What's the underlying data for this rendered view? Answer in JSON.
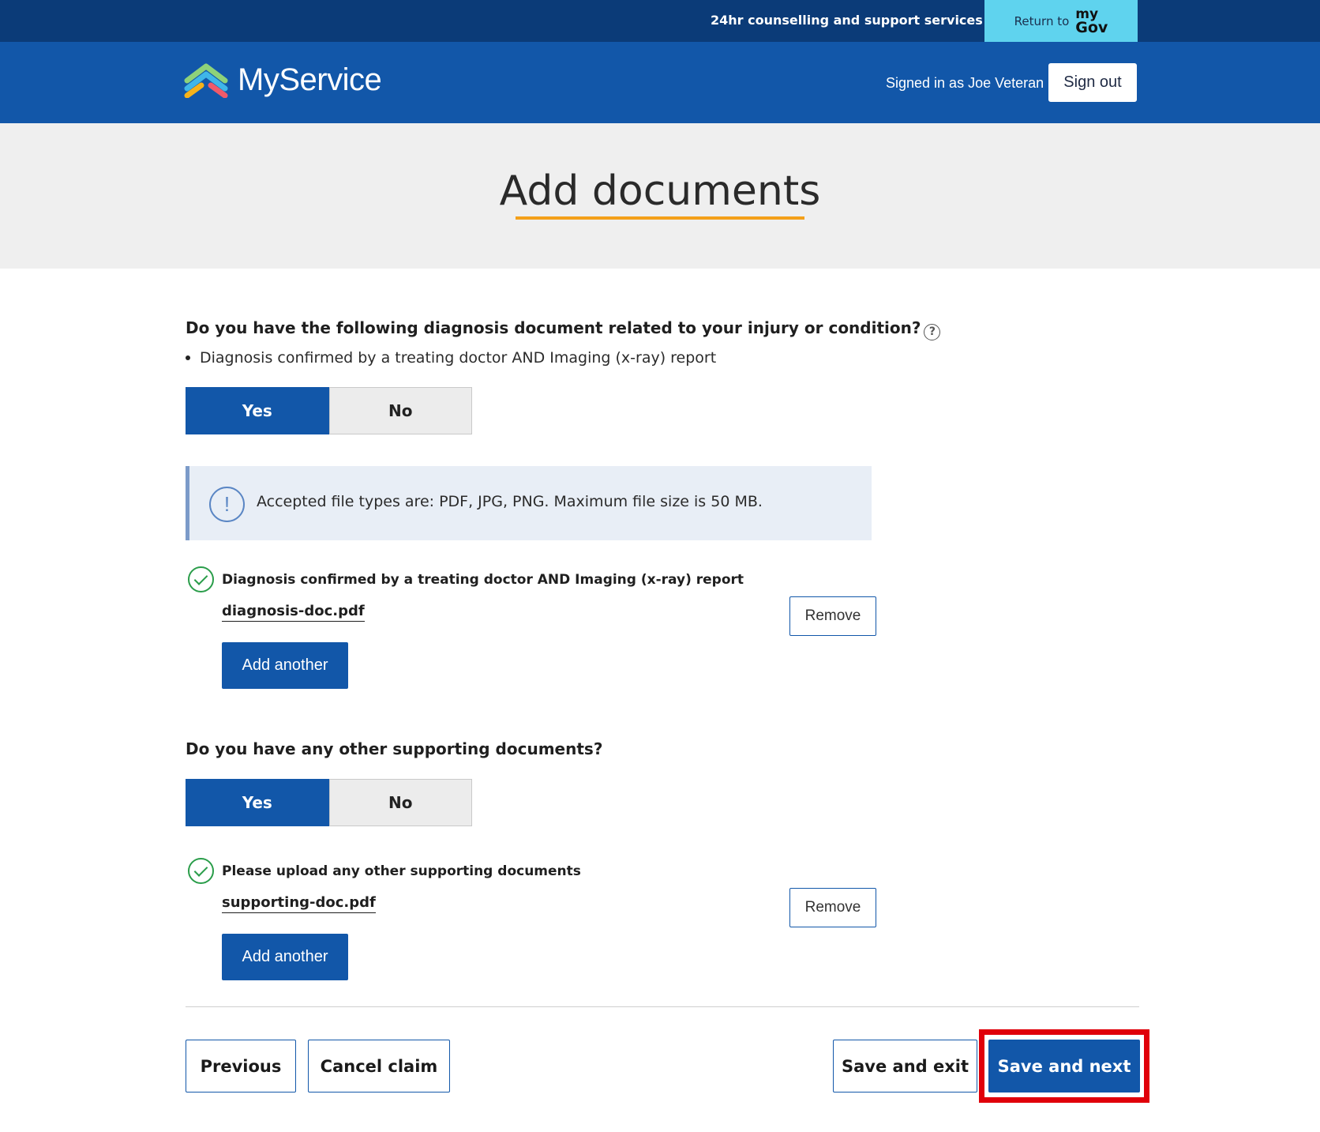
{
  "topbar": {
    "counselling_label": "24hr counselling and support services",
    "return_label": "Return to",
    "mygov_my": "my",
    "mygov_gov": "Gov"
  },
  "header": {
    "brand": "MyService",
    "signed_in": "Signed in as Joe Veteran",
    "sign_out": "Sign out"
  },
  "page": {
    "title": "Add documents"
  },
  "section1": {
    "question": "Do you have the following diagnosis document related to your injury or condition?",
    "help_icon": "?",
    "bullet": "Diagnosis confirmed by a treating doctor AND Imaging (x-ray) report",
    "yes": "Yes",
    "no": "No",
    "selected": "Yes",
    "info": "Accepted file types are: PDF, JPG, PNG. Maximum file size is 50 MB.",
    "upload_label": "Diagnosis confirmed by a treating doctor AND Imaging (x-ray) report",
    "file_name": "diagnosis-doc.pdf",
    "remove": "Remove",
    "add_another": "Add another"
  },
  "section2": {
    "question": "Do you have any other supporting documents?",
    "yes": "Yes",
    "no": "No",
    "selected": "Yes",
    "upload_label": "Please upload any other supporting documents",
    "file_name": "supporting-doc.pdf",
    "remove": "Remove",
    "add_another": "Add another"
  },
  "footer": {
    "previous": "Previous",
    "cancel": "Cancel claim",
    "save_exit": "Save and exit",
    "save_next": "Save and next"
  },
  "colors": {
    "topbar": "#0b3b78",
    "header": "#1257a9",
    "mygov_button": "#5fd3ee",
    "title_underline": "#f4a01a",
    "success": "#2a9d4a",
    "highlight": "#e0000a"
  },
  "icons": [
    "chevron-down-icon",
    "brand-logo-icon",
    "help-icon",
    "info-icon",
    "check-circle-icon"
  ]
}
